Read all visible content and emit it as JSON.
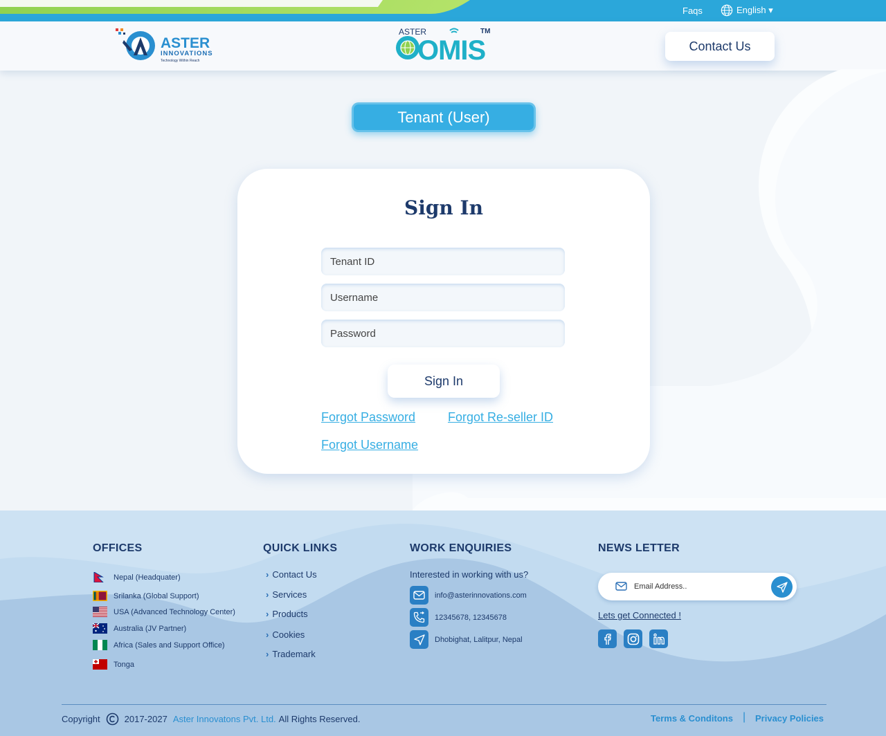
{
  "topbar": {
    "faqs": "Faqs",
    "language": "English ▾"
  },
  "header": {
    "logo_aster": {
      "word": "ASTER",
      "sub": "INNOVATIONS",
      "tagline": "Technology Within Reach"
    },
    "logo_omis": {
      "small": "ASTER",
      "word": "OMIS",
      "tm": "TM"
    },
    "contact_button": "Contact Us"
  },
  "main": {
    "tenant_pill": "Tenant (User)",
    "signin_title": "Sign In",
    "fields": {
      "tenant_placeholder": "Tenant ID",
      "username_placeholder": "Username",
      "password_placeholder": "Password"
    },
    "signin_button": "Sign In",
    "links": {
      "forgot_password": "Forgot Password",
      "forgot_reseller": "Forgot Re-seller ID",
      "forgot_username": "Forgot Username"
    }
  },
  "footer": {
    "offices_title": "OFFICES",
    "offices": [
      {
        "flag": "nepal-flag",
        "label": "Nepal (Headquater)"
      },
      {
        "flag": "srilanka-flag",
        "label": "Srilanka (Global Support)"
      },
      {
        "flag": "usa-flag",
        "label": "USA (Advanced Technology Center)"
      },
      {
        "flag": "australia-flag",
        "label": "Australia (JV Partner)"
      },
      {
        "flag": "africa-flag",
        "label": "Africa (Sales and Support Office)"
      },
      {
        "flag": "tonga-flag",
        "label": "Tonga"
      }
    ],
    "quick_links_title": "QUICK  LINKS",
    "quick_links": [
      "Contact Us",
      "Services",
      "Products",
      "Cookies",
      "Trademark"
    ],
    "work_title": "WORK ENQUIRIES",
    "work_question": "Interested in working with us?",
    "work_email": "info@asterinnovations.com",
    "work_phone": "12345678, 12345678",
    "work_address": "Dhobighat, Lalitpur, Nepal",
    "news_title": "NEWS LETTER",
    "news_placeholder": "Email Address..",
    "lets_connect": "Lets get Connected !",
    "copyright_label": "Copyright",
    "copyright_years": "2017-2027",
    "company": "Aster Innovatons Pvt. Ltd.",
    "rights": "All Rights Reserved.",
    "terms": "Terms & Conditons",
    "separator": "|",
    "privacy": "Privacy Policies"
  },
  "colors": {
    "primary": "#36aee3",
    "navy": "#1d3a6b",
    "footer_bg": "#a8c8e6",
    "green": "#8fd14f"
  }
}
